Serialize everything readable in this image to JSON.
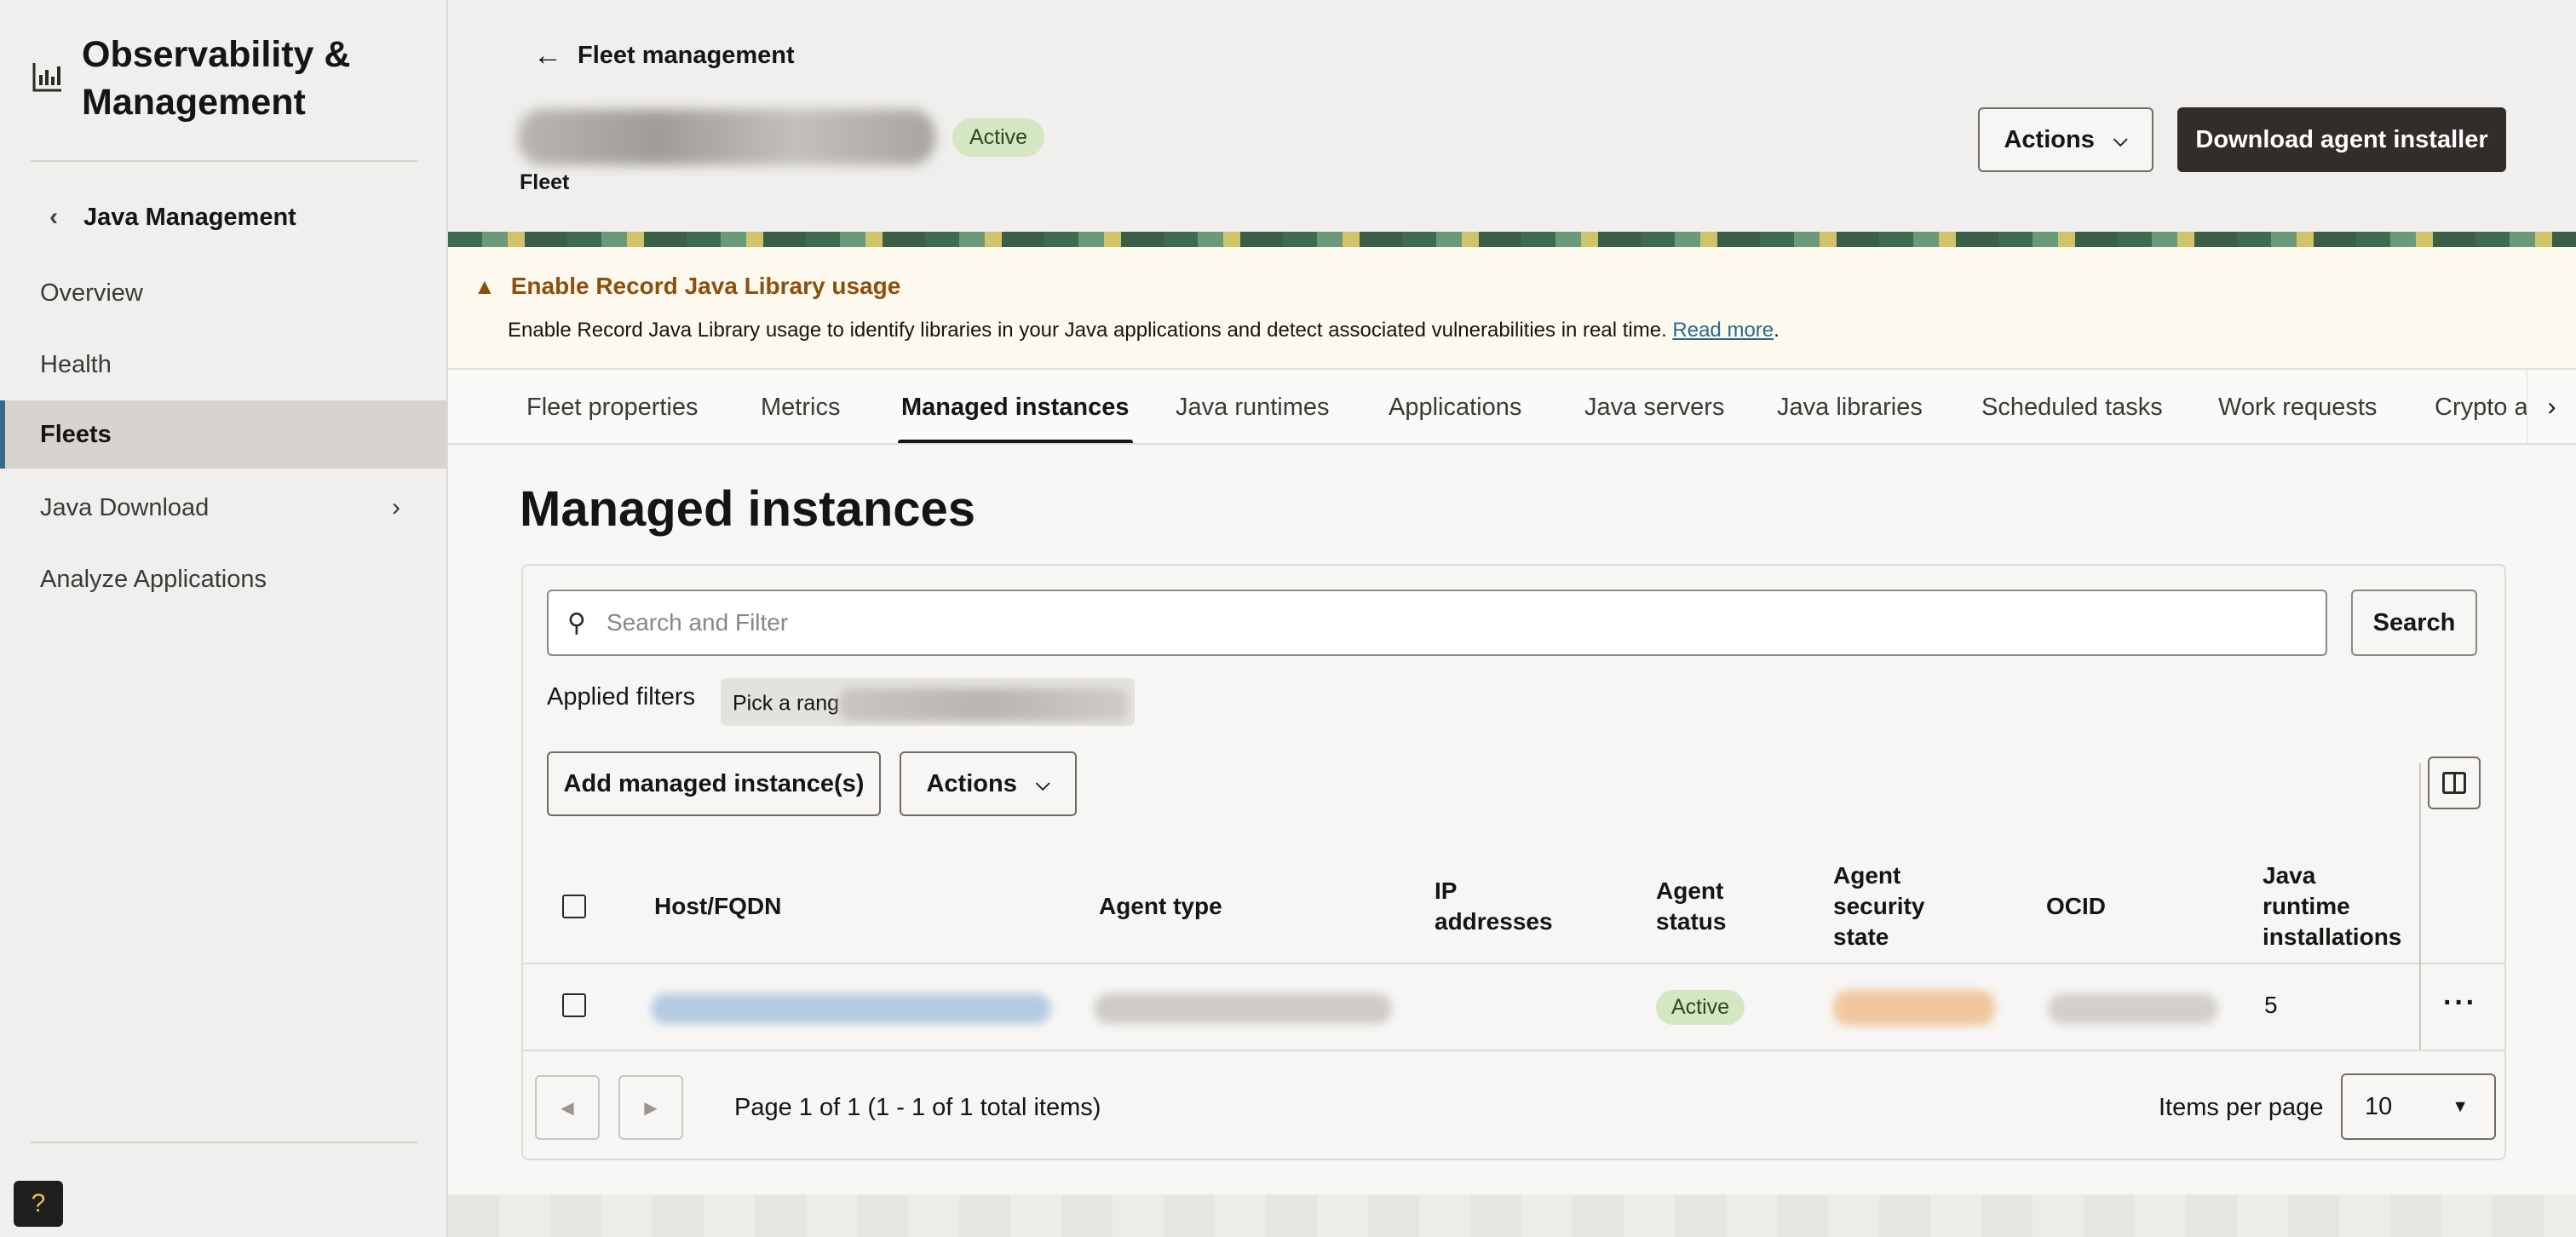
{
  "sidebar": {
    "brand_title": "Observability & Management",
    "back_label": "Java Management",
    "items": [
      {
        "label": "Overview"
      },
      {
        "label": "Health"
      },
      {
        "label": "Fleets"
      },
      {
        "label": "Java Download"
      },
      {
        "label": "Analyze Applications"
      }
    ],
    "active_item": "Fleets"
  },
  "header": {
    "breadcrumb": "Fleet management",
    "status": "Active",
    "subtitle": "Fleet",
    "actions_label": "Actions",
    "download_label": "Download agent installer"
  },
  "alert": {
    "title": "Enable Record Java Library usage",
    "text": "Enable Record Java Library usage to identify libraries in your Java applications and detect associated vulnerabilities in real time.",
    "link": "Read more",
    "link_suffix": "."
  },
  "tabs": [
    {
      "label": "Fleet properties"
    },
    {
      "label": "Metrics"
    },
    {
      "label": "Managed instances"
    },
    {
      "label": "Java runtimes"
    },
    {
      "label": "Applications"
    },
    {
      "label": "Java servers"
    },
    {
      "label": "Java libraries"
    },
    {
      "label": "Scheduled tasks"
    },
    {
      "label": "Work requests"
    },
    {
      "label": "Crypto a"
    }
  ],
  "active_tab": "Managed instances",
  "page": {
    "title": "Managed instances",
    "search_placeholder": "Search and Filter",
    "search_button": "Search",
    "applied_filters_label": "Applied filters",
    "filter_chip": "Pick a rang",
    "add_button": "Add managed instance(s)",
    "actions_label": "Actions"
  },
  "table": {
    "columns": [
      "Host/FQDN",
      "Agent type",
      "IP addresses",
      "Agent status",
      "Agent security state",
      "OCID",
      "Java runtime installations"
    ],
    "column_lines": [
      [
        "Host/FQDN"
      ],
      [
        "Agent type"
      ],
      [
        "IP",
        "addresses"
      ],
      [
        "Agent",
        "status"
      ],
      [
        "Agent",
        "security",
        "state"
      ],
      [
        "OCID"
      ],
      [
        "Java",
        "runtime",
        "installations"
      ]
    ],
    "rows": [
      {
        "agent_status": "Active",
        "java_runtime_installations": "5"
      }
    ]
  },
  "pager": {
    "text": "Page 1 of 1 (1 - 1 of 1 total items)",
    "items_per_page_label": "Items per page",
    "items_per_page": "10"
  },
  "colors": {
    "accent": "#356a8a",
    "primary_button": "#312d2a",
    "success_pill": "#d4e6c2",
    "warning_text": "#8c4f0e"
  }
}
